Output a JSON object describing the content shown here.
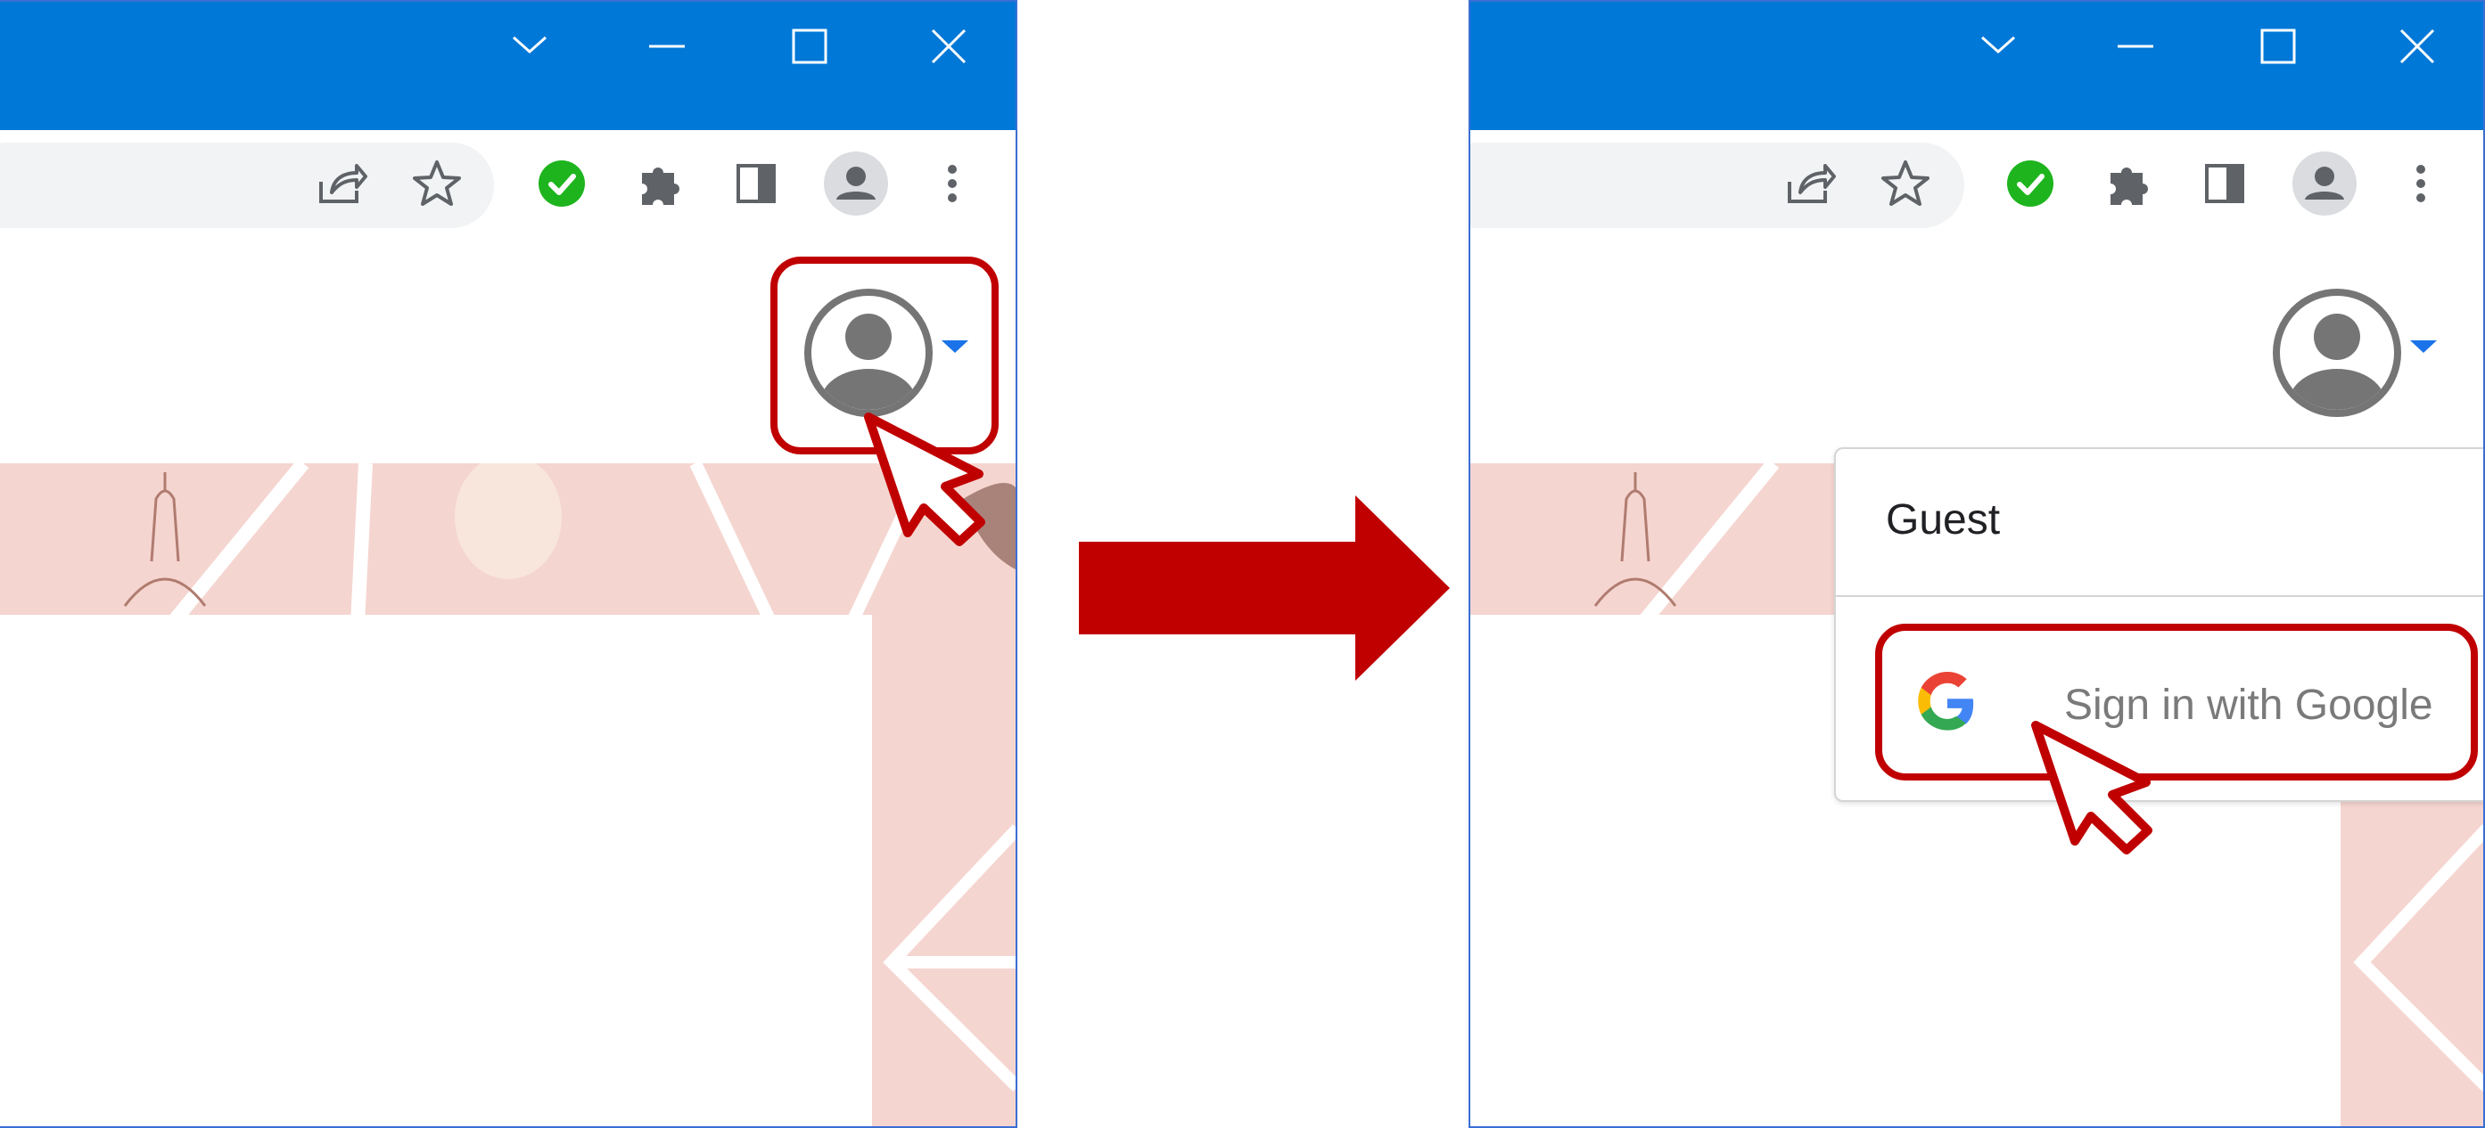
{
  "left_panel": {
    "window_controls": [
      "chevron-down-icon",
      "minimize-icon",
      "maximize-icon",
      "close-icon"
    ],
    "toolbar_icons": [
      "share-icon",
      "star-icon",
      "extension-check-icon",
      "puzzle-icon",
      "side-panel-icon",
      "profile-icon",
      "more-icon"
    ]
  },
  "right_panel": {
    "window_controls": [
      "chevron-down-icon",
      "minimize-icon",
      "maximize-icon",
      "close-icon"
    ],
    "toolbar_icons": [
      "share-icon",
      "star-icon",
      "extension-check-icon",
      "puzzle-icon",
      "side-panel-icon",
      "profile-icon",
      "more-icon"
    ],
    "account_menu": {
      "guest_label": "Guest",
      "signin_label": "Sign in with Google"
    }
  },
  "colors": {
    "title_bar": "#0078d7",
    "highlight": "#c00000",
    "arrow": "#c00000",
    "banner": "#f5d5d0",
    "check": "#1eb41e"
  }
}
